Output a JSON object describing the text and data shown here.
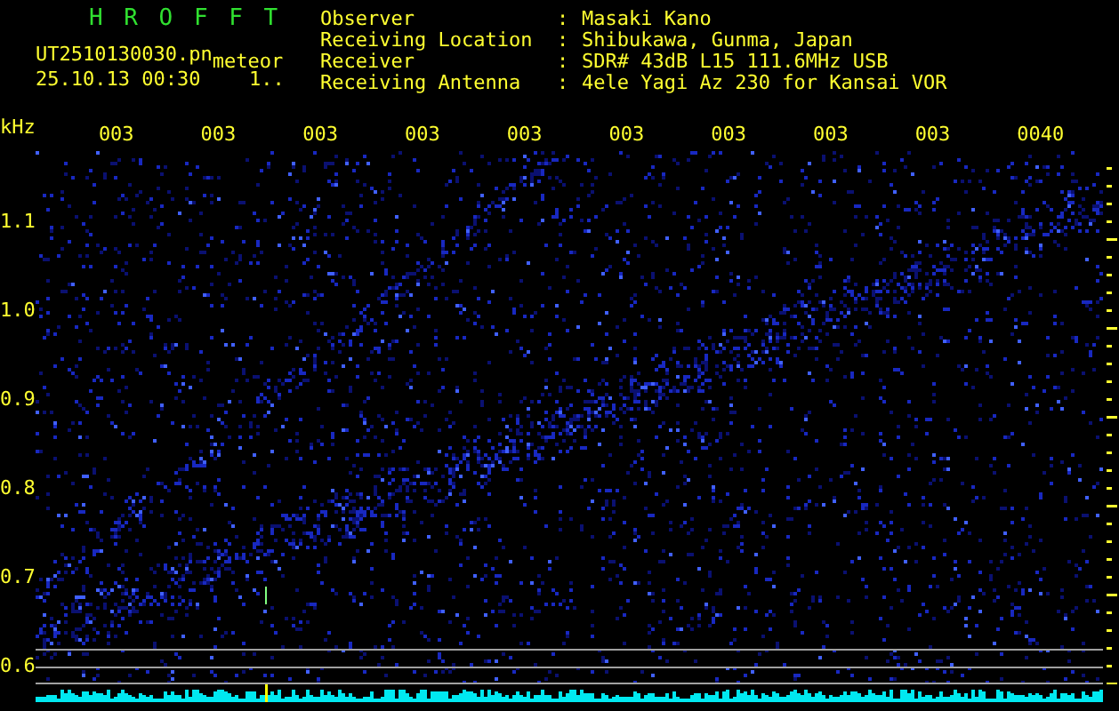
{
  "header": {
    "title": "H R O F F T",
    "file": "UT2510130030.pn",
    "tag": "meteor",
    "datetime": "25.10.13 00:30",
    "code": "1..",
    "info": [
      {
        "label": "Observer",
        "sep": ":",
        "value": "Masaki Kano"
      },
      {
        "label": "Receiving Location",
        "sep": ":",
        "value": "Shibukawa, Gunma, Japan"
      },
      {
        "label": "Receiver",
        "sep": ":",
        "value": "SDR# 43dB L15 111.6MHz USB"
      },
      {
        "label": "Receiving Antenna",
        "sep": ":",
        "value": "4ele Yagi Az 230 for Kansai VOR"
      }
    ]
  },
  "time_axis": {
    "labels": [
      "003",
      "003",
      "003",
      "003",
      "003",
      "003",
      "003",
      "003",
      "003",
      "0040"
    ]
  },
  "freq_axis": {
    "unit": "kHz",
    "ticks": [
      "1.1",
      "1.0",
      "0.9",
      "0.8",
      "0.7",
      "0.6"
    ]
  }
}
